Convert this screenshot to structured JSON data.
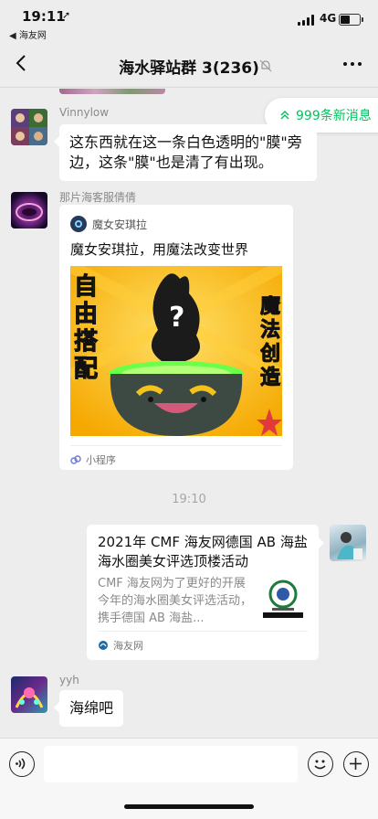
{
  "status_bar": {
    "time": "19:11",
    "location_icon": "location-arrow-icon",
    "back_app": "◀ 海友网",
    "network": "4G",
    "battery_level": 0.55
  },
  "nav": {
    "title": "海水驿站群 3(236)",
    "back_icon": "chevron-left-icon",
    "mute_icon": "bell-off-icon",
    "more_icon": "more-dots-icon"
  },
  "new_messages": {
    "icon": "double-chevron-up-icon",
    "label": "999条新消息",
    "color": "#07c160"
  },
  "messages": [
    {
      "sender": "Vinnylow",
      "text": "这东西就在这一条白色透明的\"膜\"旁边，这条\"膜\"也是清了有出现。"
    },
    {
      "sender": "那片海客服倩倩",
      "mini_program": {
        "source": "魔女安琪拉",
        "title": "魔女安琪拉，用魔法改变世界",
        "image_text_left": "自由搭配",
        "image_text_right": "魔法创造",
        "footer": "小程序"
      }
    },
    {
      "timestamp": "19:10"
    },
    {
      "self": true,
      "article": {
        "title": "2021年 CMF 海友网德国 AB 海盐海水圈美女评选顶楼活动",
        "description": "CMF 海友网为了更好的开展今年的海水圈美女评选活动，携手德国 AB 海盐...",
        "source": "海友网"
      }
    },
    {
      "sender": "yyh",
      "text": "海绵吧"
    }
  ],
  "input_bar": {
    "placeholder": "",
    "voice_icon": "voice-icon",
    "emoji_icon": "emoji-icon",
    "plus_icon": "plus-icon"
  }
}
